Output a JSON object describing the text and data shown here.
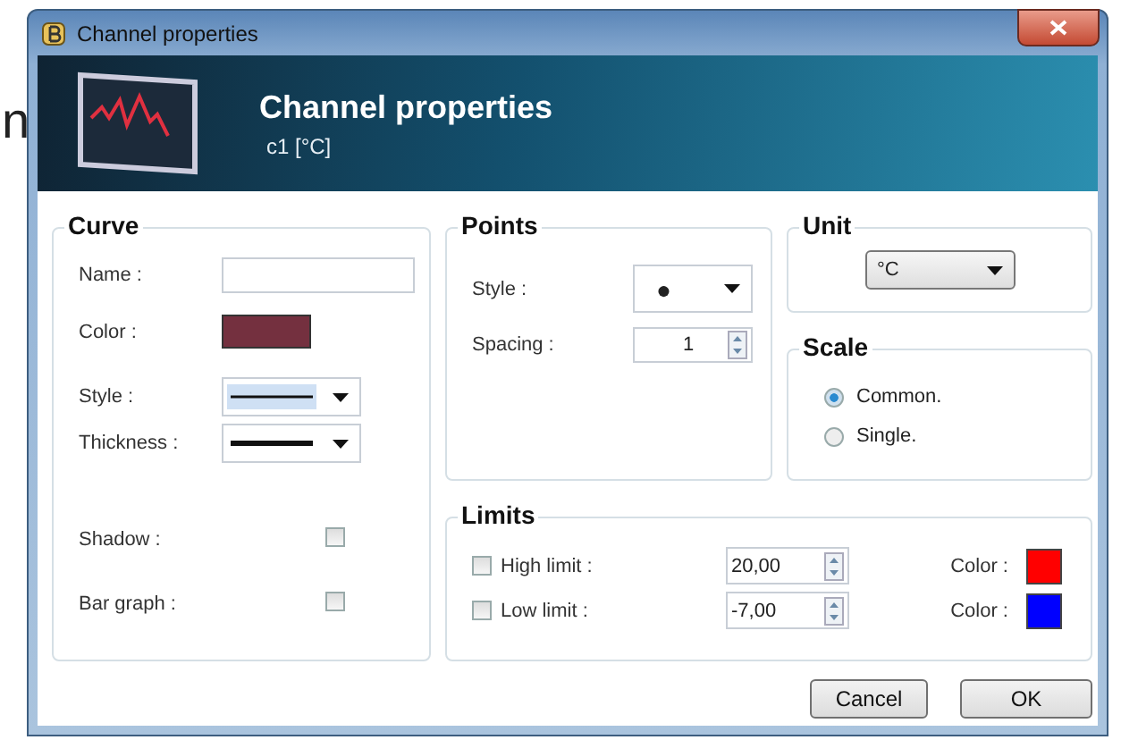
{
  "background_text": "n",
  "window": {
    "title": "Channel properties",
    "header_title": "Channel properties",
    "header_subtitle": "c1 [°C]"
  },
  "curve": {
    "title": "Curve",
    "name_label": "Name :",
    "color_label": "Color :",
    "color": "#74303f",
    "style_label": "Style :",
    "thickness_label": "Thickness :",
    "shadow_label": "Shadow :",
    "shadow_checked": false,
    "bar_graph_label": "Bar graph :",
    "bar_graph_checked": false
  },
  "points": {
    "title": "Points",
    "style_label": "Style :",
    "style_value": "●",
    "spacing_label": "Spacing :",
    "spacing_value": "1"
  },
  "unit": {
    "title": "Unit",
    "value": "°C"
  },
  "scale": {
    "title": "Scale",
    "options": [
      {
        "label": "Common.",
        "selected": true
      },
      {
        "label": "Single.",
        "selected": false
      }
    ]
  },
  "limits": {
    "title": "Limits",
    "items": [
      {
        "label": "High limit :",
        "checked": false,
        "value": "20,00",
        "color_label": "Color :",
        "color": "#ff0000"
      },
      {
        "label": "Low limit :",
        "checked": false,
        "value": "-7,00",
        "color_label": "Color :",
        "color": "#0000ff"
      }
    ]
  },
  "buttons": [
    "Cancel",
    "OK"
  ]
}
